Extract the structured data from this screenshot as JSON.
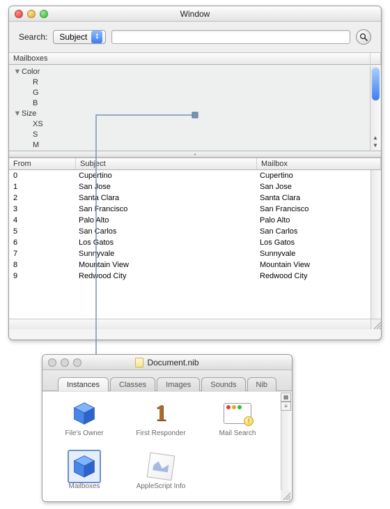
{
  "main_window": {
    "title": "Window",
    "search": {
      "label": "Search:",
      "dropdown_value": "Subject",
      "input_value": "",
      "placeholder": ""
    },
    "mailboxes_header": "Mailboxes",
    "outline": [
      {
        "label": "Color",
        "level": 0,
        "expanded": true
      },
      {
        "label": "R",
        "level": 1
      },
      {
        "label": "G",
        "level": 1
      },
      {
        "label": "B",
        "level": 1
      },
      {
        "label": "Size",
        "level": 0,
        "expanded": true
      },
      {
        "label": "XS",
        "level": 1
      },
      {
        "label": "S",
        "level": 1
      },
      {
        "label": "M",
        "level": 1
      }
    ],
    "table": {
      "columns": [
        "From",
        "Subject",
        "Mailbox"
      ],
      "rows": [
        {
          "from": "0",
          "subject": "Cupertino",
          "mailbox": "Cupertino"
        },
        {
          "from": "1",
          "subject": "San Jose",
          "mailbox": "San Jose"
        },
        {
          "from": "2",
          "subject": "Santa Clara",
          "mailbox": "Santa Clara"
        },
        {
          "from": "3",
          "subject": "San Francisco",
          "mailbox": "San Francisco"
        },
        {
          "from": "4",
          "subject": "Palo Alto",
          "mailbox": "Palo Alto"
        },
        {
          "from": "5",
          "subject": "San Carlos",
          "mailbox": "San Carlos"
        },
        {
          "from": "6",
          "subject": "Los Gatos",
          "mailbox": "Los Gatos"
        },
        {
          "from": "7",
          "subject": "Sunnyvale",
          "mailbox": "Sunnyvale"
        },
        {
          "from": "8",
          "subject": "Mountain View",
          "mailbox": "Mountain View"
        },
        {
          "from": "9",
          "subject": "Redwood City",
          "mailbox": "Redwood City"
        }
      ]
    }
  },
  "nib_window": {
    "title": "Document.nib",
    "tabs": [
      "Instances",
      "Classes",
      "Images",
      "Sounds",
      "Nib"
    ],
    "active_tab": 0,
    "items": [
      {
        "name": "File's Owner",
        "icon": "cube",
        "selected": false
      },
      {
        "name": "First Responder",
        "icon": "one",
        "selected": false
      },
      {
        "name": "Mail Search",
        "icon": "window",
        "selected": false
      },
      {
        "name": "Mailboxes",
        "icon": "cube",
        "selected": true
      },
      {
        "name": "AppleScript Info",
        "icon": "script",
        "selected": false
      }
    ]
  }
}
